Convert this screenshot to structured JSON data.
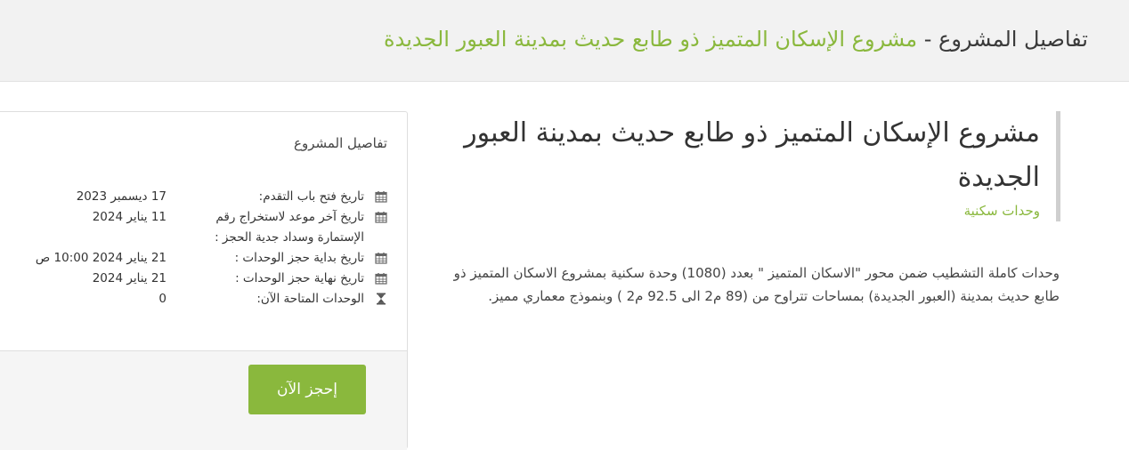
{
  "header": {
    "title_prefix": "تفاصيل المشروع - ",
    "title_project": "مشروع الإسكان المتميز ذو طابع حديث بمدينة العبور الجديدة"
  },
  "project": {
    "title": "مشروع الإسكان المتميز ذو طابع حديث بمدينة العبور الجديدة",
    "category": "وحدات سكنية",
    "description": "وحدات كاملة التشطيب ضمن محور \"الاسكان المتميز \" بعدد (1080) وحدة سكنية بمشروع الاسكان المتميز ذو طابع حديث بمدينة (العبور الجديدة) بمساحات تتراوح من (89 م2 الى 92.5 م2 ) وبنموذج معماري مميز."
  },
  "details_card": {
    "title": "تفاصيل المشروع",
    "rows": [
      {
        "icon": "calendar-icon",
        "label": "تاريخ فتح باب التقدم:",
        "value": "17 ديسمبر 2023"
      },
      {
        "icon": "calendar-icon",
        "label": "تاريخ آخر موعد لاستخراج رقم الإستمارة وسداد جدية الحجز :",
        "value": "11 يناير 2024"
      },
      {
        "icon": "calendar-icon",
        "label": "تاريخ بداية حجز الوحدات :",
        "value": "21 يناير 2024 10:00 ص"
      },
      {
        "icon": "calendar-icon",
        "label": "تاريخ نهاية حجز الوحدات :",
        "value": "21 يناير 2024"
      },
      {
        "icon": "hourglass-icon",
        "label": "الوحدات المتاحة الآن:",
        "value": "0"
      }
    ],
    "book_button": "إحجز الآن"
  },
  "colors": {
    "accent": "#8ab83d",
    "header_bg": "#f2f2f2",
    "text": "#333333"
  }
}
